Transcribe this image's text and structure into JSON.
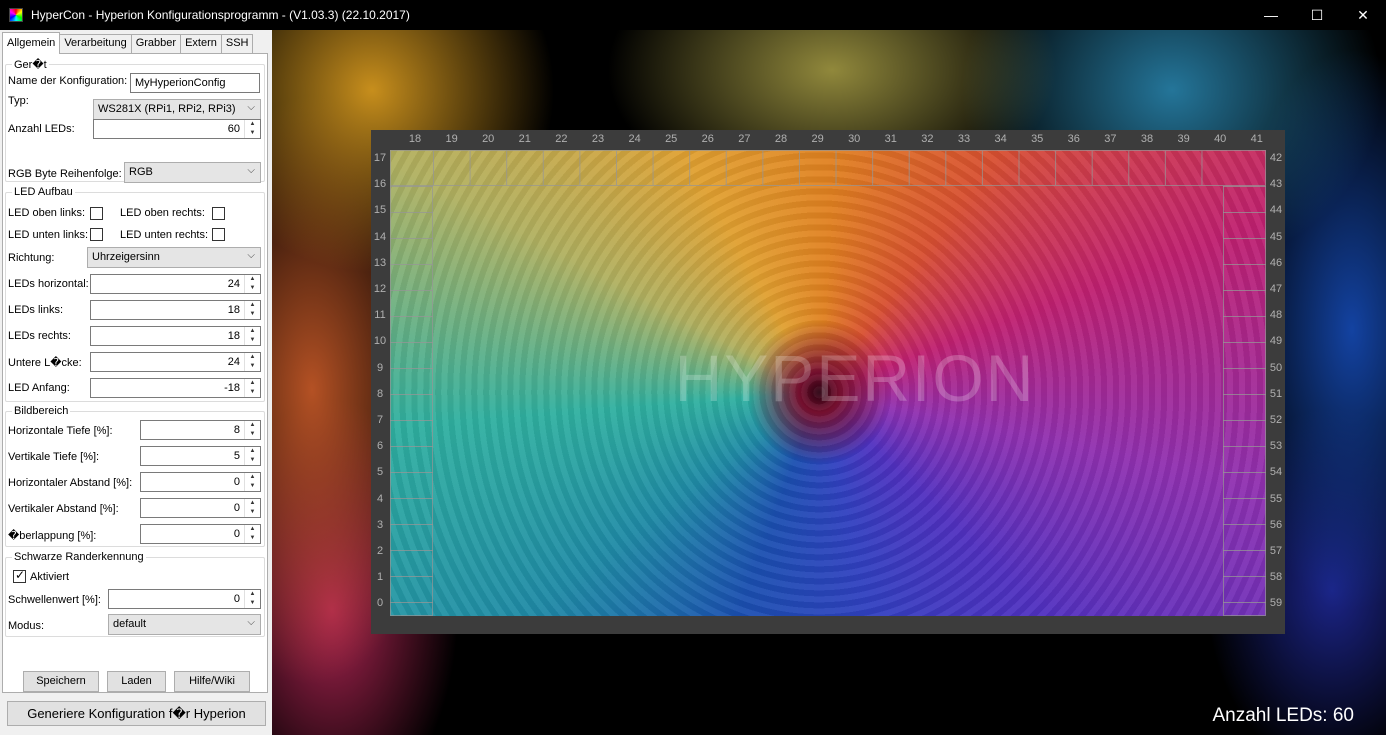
{
  "window": {
    "title": "HyperCon - Hyperion Konfigurationsprogramm - (V1.03.3) (22.10.2017)",
    "minimize": "—",
    "maximize": "☐",
    "close": "✕"
  },
  "tabs": [
    "Allgemein",
    "Verarbeitung",
    "Grabber",
    "Extern",
    "SSH"
  ],
  "device": {
    "group_title": "Ger�t",
    "config_name_label": "Name der Konfiguration:",
    "config_name_value": "MyHyperionConfig",
    "type_label": "Typ:",
    "type_value": "WS281X (RPi1, RPi2, RPi3)",
    "led_count_label": "Anzahl LEDs:",
    "led_count_value": "60",
    "rgb_order_label": "RGB Byte Reihenfolge:",
    "rgb_order_value": "RGB"
  },
  "layout": {
    "group_title": "LED Aufbau",
    "top_left_label": "LED oben links:",
    "top_right_label": "LED oben rechts:",
    "bottom_left_label": "LED unten links:",
    "bottom_right_label": "LED unten rechts:",
    "direction_label": "Richtung:",
    "direction_value": "Uhrzeigersinn",
    "horizontal_label": "LEDs horizontal:",
    "horizontal_value": "24",
    "left_label": "LEDs links:",
    "left_value": "18",
    "right_label": "LEDs rechts:",
    "right_value": "18",
    "gap_label": "Untere L�cke:",
    "gap_value": "24",
    "start_label": "LED Anfang:",
    "start_value": "-18"
  },
  "image_area": {
    "group_title": "Bildbereich",
    "h_depth_label": "Horizontale Tiefe [%]:",
    "h_depth_value": "8",
    "v_depth_label": "Vertikale Tiefe [%]:",
    "v_depth_value": "5",
    "h_gap_label": "Horizontaler Abstand [%]:",
    "h_gap_value": "0",
    "v_gap_label": "Vertikaler Abstand [%]:",
    "v_gap_value": "0",
    "overlap_label": "�berlappung [%]:",
    "overlap_value": "0"
  },
  "blackborder": {
    "group_title": "Schwarze Randerkennung",
    "enabled_label": "Aktiviert",
    "enabled": true,
    "threshold_label": "Schwellenwert [%]:",
    "threshold_value": "0",
    "mode_label": "Modus:",
    "mode_value": "default"
  },
  "buttons": {
    "save": "Speichern",
    "load": "Laden",
    "help": "Hilfe/Wiki",
    "generate": "Generiere Konfiguration f�r Hyperion"
  },
  "preview": {
    "logo_text": "HYPERION",
    "led_count_text": "Anzahl LEDs: 60",
    "top_numbers": [
      "18",
      "19",
      "20",
      "21",
      "22",
      "23",
      "24",
      "25",
      "26",
      "27",
      "28",
      "29",
      "30",
      "31",
      "32",
      "33",
      "34",
      "35",
      "36",
      "37",
      "38",
      "39",
      "40",
      "41"
    ],
    "left_numbers": [
      "17",
      "16",
      "15",
      "14",
      "13",
      "12",
      "11",
      "10",
      "9",
      "8",
      "7",
      "6",
      "5",
      "4",
      "3",
      "2",
      "1",
      "0"
    ],
    "right_numbers": [
      "42",
      "43",
      "44",
      "45",
      "46",
      "47",
      "48",
      "49",
      "50",
      "51",
      "52",
      "53",
      "54",
      "55",
      "56",
      "57",
      "58",
      "59"
    ]
  }
}
